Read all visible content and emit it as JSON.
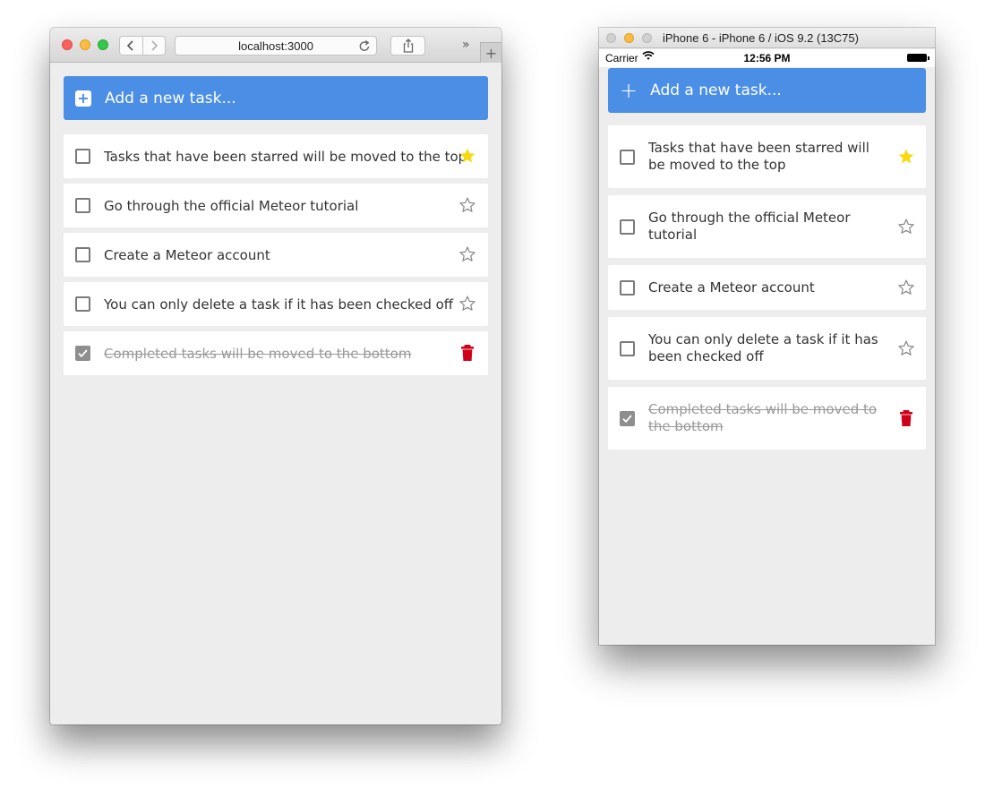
{
  "browser": {
    "url": "localhost:3000",
    "more_label": "»",
    "new_tab_label": "+"
  },
  "simulator": {
    "title": "iPhone 6 - iPhone 6 / iOS 9.2 (13C75)",
    "status": {
      "carrier": "Carrier",
      "time": "12:56 PM"
    }
  },
  "app": {
    "add_placeholder": "Add a new task...",
    "tasks": [
      {
        "text": "Tasks that have been starred will be moved to the top",
        "starred": true,
        "completed": false,
        "action_icon": "star-filled-icon"
      },
      {
        "text": "Go through the official Meteor tutorial",
        "starred": false,
        "completed": false,
        "action_icon": "star-outline-icon"
      },
      {
        "text": "Create a Meteor account",
        "starred": false,
        "completed": false,
        "action_icon": "star-outline-icon"
      },
      {
        "text": "You can only delete a task if it has been checked off",
        "starred": false,
        "completed": false,
        "action_icon": "star-outline-icon"
      },
      {
        "text": "Completed tasks will be moved to the bottom",
        "starred": false,
        "completed": true,
        "action_icon": "trash-icon"
      }
    ]
  },
  "colors": {
    "accent": "#4b8ee6",
    "star_active": "#f8d90f",
    "star_inactive": "#8a8a8a",
    "delete": "#d0021b",
    "background": "#ededed"
  }
}
